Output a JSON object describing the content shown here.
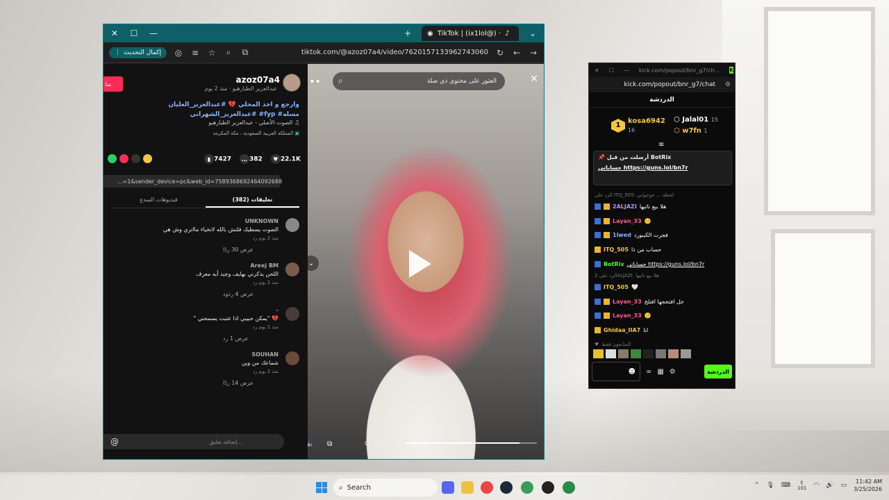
{
  "browser": {
    "tab_title": "TikTok | (ix1lol@) ·",
    "update_button": "إكمال التحديث",
    "url": "tiktok.com/@azoz07a4/video/7620157133962743060"
  },
  "tiktok": {
    "username": "azoz07a4",
    "follow_label": "متا",
    "meta": "عبدالعزيز الطيارهيو · منذ 2 يوم",
    "description": "وارجع و اخذ المحلي 💔 #عبدالعزيز_العليان #عبدالعزيز_الشهراني #fyp #مسله",
    "sound": "الصوت الأصلي - عبدالعزيز الطيارهيو",
    "location": "المملكة العربية السعودية ، مكة المكرمة",
    "stats": {
      "likes": "22.1K",
      "comments": "382",
      "saves": "7427"
    },
    "link_text": "...=1&sender_device=pc&web_id=7589368692464092688",
    "tab_comments": "تعليقات (382)",
    "tab_creator": "فيديوهات المبدع",
    "comments": [
      {
        "name": "UNKNOWN",
        "text": "الصوت يسطيك فلتش بالله لاتخياء مااتري وش هي",
        "meta": "منذ 2 يوم   رد",
        "replies": "عرض 30 ردًا"
      },
      {
        "name": "Areej BM",
        "text": "اللحن يذكرني بهايف وجيد أيه معرف",
        "meta": "منذ 2 يوم   رد",
        "replies": "عرض 4 ردود"
      },
      {
        "name": "-",
        "text": "\" يمكن حبيبي اذا عتبت يسمحني\" 💔",
        "meta": "منذ 1 يوم   رد",
        "replies": "عرض 1 رد"
      },
      {
        "name": "SOUHAN",
        "text": "شماعك من وين",
        "meta": "منذ 2 يوم   رد",
        "replies": "عرض 14 ردًا"
      }
    ],
    "comment_placeholder": "إضافة تعليق...",
    "at_symbol": "@"
  },
  "video": {
    "search_placeholder": "العثور على محتوى ذي صلة",
    "time": "00:49/00:56",
    "progress": 0.87
  },
  "kick": {
    "window_url": "kick.com/popout/bnr_g7/ch...",
    "address": "kick.com/popout/bnr_g7/chat",
    "header": "الدردشة",
    "top_gifters": [
      {
        "rank": "1",
        "name": "kosa6942",
        "count": "16"
      },
      {
        "name": "Jalal01",
        "count": "15"
      },
      {
        "name": "w7fn",
        "count": "1"
      }
    ],
    "pinned_title": "أرسلت من قبل BotRix",
    "pinned_text": "حساباتي https://guns.lol/bn7r",
    "messages": [
      {
        "reply": "الرد على ITQ_505: لحظة ... جوجوابي"
      },
      {
        "name": "2ALJAZI",
        "text": "هلا بيع ناتيها",
        "color": "#c08cff"
      },
      {
        "name": "Layan_33",
        "text": "🙂",
        "color": "#ff5c8a"
      },
      {
        "name": "1lwed",
        "text": "فجرت الكيبورد",
        "color": "#8ab4f8"
      },
      {
        "name": "ITQ_505",
        "text": "حساب من ذا",
        "color": "#f5c542"
      },
      {
        "name": "BotRix",
        "text": "حساباتي https://guns.lol/bn7r",
        "color": "#53fc18"
      },
      {
        "reply": "الرد على 2ALJAZI: هلا بيع ناتيها"
      },
      {
        "name": "ITQ_505",
        "text": "🤍",
        "color": "#f5c542"
      },
      {
        "name": "Layan_33",
        "text": "خل افتحجها افتلج",
        "color": "#ff5c8a"
      },
      {
        "name": "Layan_33",
        "text": "🙂",
        "color": "#ff5c8a"
      },
      {
        "name": "Ghidaa_IIA7",
        "text": "انا",
        "color": "#f5c542"
      }
    ],
    "followers_only": "المتابعون فقط",
    "send_label": "الدردشة"
  },
  "taskbar": {
    "search": "Search",
    "lang": "ع\n101",
    "time": "11:42 AM",
    "date": "3/25/2026"
  }
}
